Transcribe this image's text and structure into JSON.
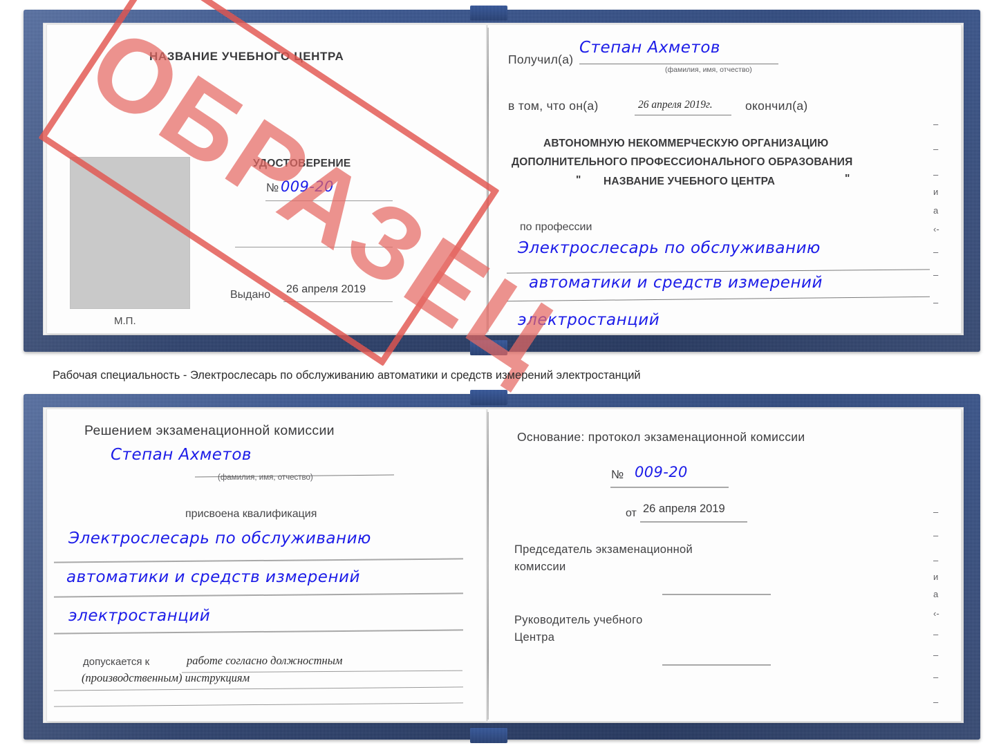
{
  "caption": {
    "text": "Рабочая специальность - Электрослесарь по обслуживанию автоматики и средств измерений электростанций"
  },
  "stamp": {
    "label": "ОБРАЗЕЦ",
    "color": "#e4625c"
  },
  "colors": {
    "cover_blue": "#27437e",
    "ink_blue": "#1c1ce8",
    "stamp_red": "#e4625c",
    "photo_gray": "#c9c9c9",
    "paper": "#fdfdfd"
  },
  "certificate_one": {
    "left_page": {
      "heading": "НАЗВАНИЕ УЧЕБНОГО ЦЕНТРА",
      "doc_type": "УДОСТОВЕРЕНИЕ",
      "number_symbol": "№",
      "number_value": "009-20",
      "issued_label": "Выдано",
      "issued_value": "26 апреля 2019",
      "seal_label": "М.П.",
      "photo_placeholder": "photo-box"
    },
    "right_page": {
      "received_label": "Получил(а)",
      "received_value": "Степан Ахметов",
      "name_hint": "(фамилия, имя, отчество)",
      "in_that_label": "в том, что он(а)",
      "completion_date": "26 апреля 2019г.",
      "finished_label": "окончил(а)",
      "org_line1": "АВТОНОМНУЮ НЕКОММЕРЧЕСКУЮ ОРГАНИЗАЦИЮ",
      "org_line2": "ДОПОЛНИТЕЛЬНОГО ПРОФЕССИОНАЛЬНОГО ОБРАЗОВАНИЯ",
      "org_quote_open": "\"",
      "org_name": "НАЗВАНИЕ УЧЕБНОГО ЦЕНТРА",
      "org_quote_close": "\"",
      "profession_label": "по профессии",
      "profession_line1": "Электрослесарь по обслуживанию",
      "profession_line2": "автоматики и средств измерений",
      "profession_line3": "электростанций",
      "edge_fragments": [
        "–",
        "–",
        "–",
        "и",
        "а",
        "‹-",
        "–",
        "–",
        "–"
      ]
    }
  },
  "certificate_two": {
    "left_page": {
      "heading": "Решением экзаменационной комиссии",
      "name_value": "Степан Ахметов",
      "name_hint": "(фамилия, имя, отчество)",
      "qualification_label": "присвоена квалификация",
      "qualification_line1": "Электрослесарь по обслуживанию",
      "qualification_line2": "автоматики и средств измерений",
      "qualification_line3": "электростанций",
      "admitted_label": "допускается к",
      "admitted_value_line1": "работе согласно должностным",
      "admitted_value_line2": "(производственным) инструкциям"
    },
    "right_page": {
      "basis_label": "Основание: протокол экзаменационной комиссии",
      "number_symbol": "№",
      "number_value": "009-20",
      "from_label": "от",
      "from_value": "26 апреля 2019",
      "chairman_line1": "Председатель экзаменационной",
      "chairman_line2": "комиссии",
      "head_line1": "Руководитель учебного",
      "head_line2": "Центра",
      "edge_fragments": [
        "–",
        "–",
        "–",
        "и",
        "а",
        "‹-",
        "–",
        "–",
        "–",
        "–"
      ]
    }
  }
}
